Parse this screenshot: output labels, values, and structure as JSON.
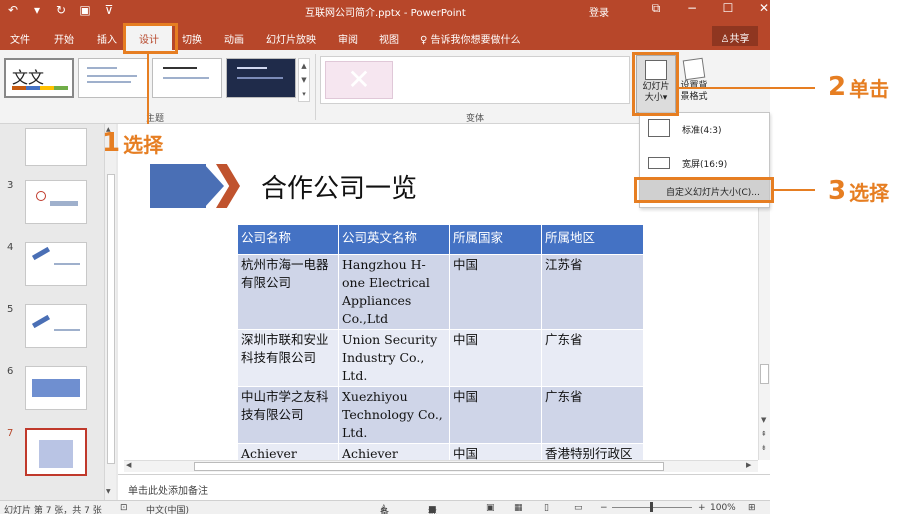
{
  "window": {
    "title": "互联网公司简介.pptx - PowerPoint",
    "sign_in": "登录",
    "controls": [
      "⧉",
      "−",
      "☐",
      "✕"
    ],
    "qat_icons": [
      "save-icon",
      "undo-icon",
      "redo-icon",
      "start-slideshow-icon",
      "customize-icon"
    ]
  },
  "ribbon": {
    "tabs": [
      "文件",
      "开始",
      "插入",
      "设计",
      "切换",
      "动画",
      "幻灯片放映",
      "审阅",
      "视图"
    ],
    "active_tab": "设计",
    "tell_me": "告诉我你想要做什么",
    "share": "共享",
    "groups": {
      "themes": "主题",
      "variants": "变体"
    },
    "theme_preview_text": "文文",
    "slide_size_label_1": "幻灯片",
    "slide_size_label_2": "大小",
    "format_bg_label_1": "设置背",
    "format_bg_label_2": "景格式"
  },
  "slide_size_menu": {
    "standard": "标准(4:3)",
    "widescreen": "宽屏(16:9)",
    "custom": "自定义幻灯片大小(C)..."
  },
  "thumbnails": {
    "numbers": [
      "3",
      "4",
      "5",
      "6",
      "7"
    ],
    "active": "7"
  },
  "slide": {
    "title": "合作公司一览",
    "table": {
      "headers": [
        "公司名称",
        "公司英文名称",
        "所属国家",
        "所属地区"
      ],
      "rows": [
        [
          "杭州市海一电器有限公司",
          "Hangzhou H-one Electrical Appliances Co.,Ltd",
          "中国",
          "江苏省"
        ],
        [
          "深圳市联和安业科技有限公司",
          "Union Security Industry Co., Ltd.",
          "中国",
          "广东省"
        ],
        [
          "中山市学之友科技有限公司",
          "Xuezhiyou Technology Co., Ltd.",
          "中国",
          "广东省"
        ],
        [
          "Achiever",
          "Achiever",
          "中国",
          "香港特别行政区"
        ]
      ]
    }
  },
  "notes_placeholder": "单击此处添加备注",
  "status_bar": {
    "slide_info": "幻灯片 第 7 张，共 7 张",
    "language": "中文(中国)",
    "notes": "备注",
    "comments": "批注",
    "zoom": "100%"
  },
  "annotations": [
    {
      "num": "1",
      "text": "选择"
    },
    {
      "num": "2",
      "text": "单击"
    },
    {
      "num": "3",
      "text": "选择"
    }
  ],
  "colors": {
    "accent": "#b7472a",
    "callout": "#e67e22",
    "table_header": "#4472c4"
  }
}
